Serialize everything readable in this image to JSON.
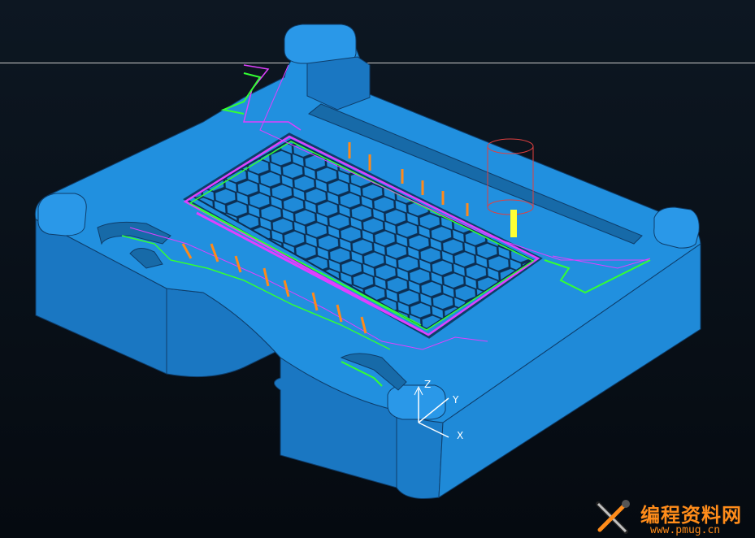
{
  "scene": {
    "background": "#0a121b",
    "part_color": "#1f8ad8",
    "part_shadow": "#1667b0",
    "toolpath_colors": {
      "magenta": "#e040ff",
      "green": "#33ff33",
      "orange": "#ff8a1a",
      "yellow": "#ffff33",
      "white": "#ffffff"
    },
    "tool_color": "#e04040"
  },
  "axes": {
    "z": "Z",
    "y": "Y",
    "x": "X"
  },
  "watermark": {
    "title": "编程资料网",
    "url": "www.pmug.cn",
    "icon": "wrench-screwdriver-icon",
    "color": "#ff8c1a"
  }
}
